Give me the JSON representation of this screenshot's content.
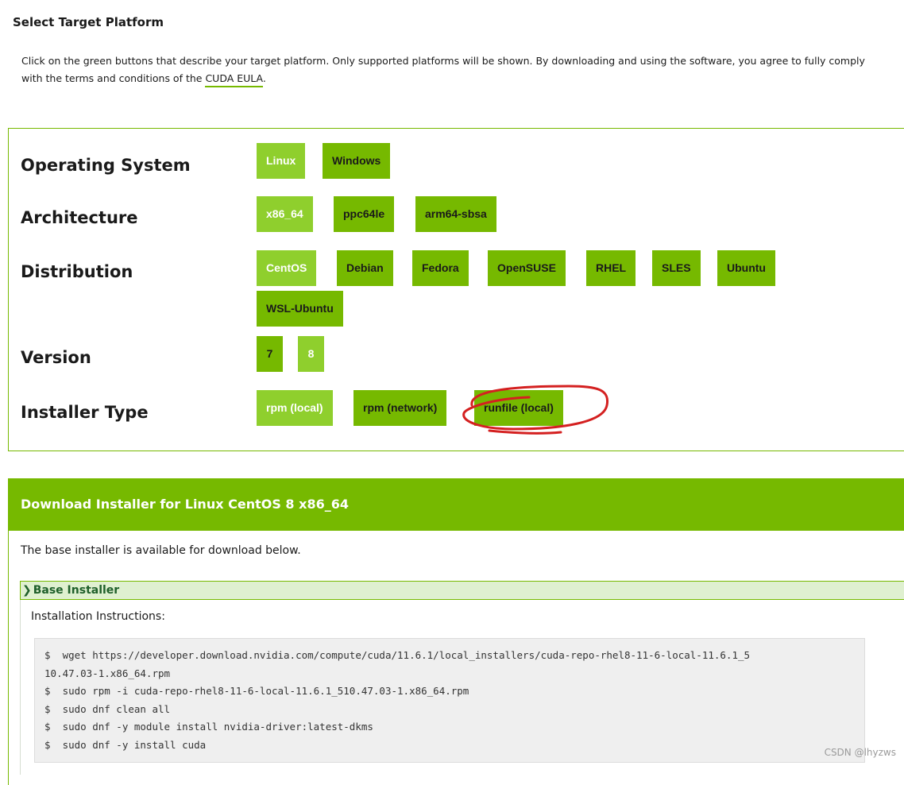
{
  "section_title": "Select Target Platform",
  "intro": {
    "text": "Click on the green buttons that describe your target platform. Only supported platforms will be shown. By downloading and using the software, you agree to fully comply with the terms and conditions of the ",
    "link": "CUDA EULA",
    "suffix": "."
  },
  "selector": {
    "operating_system": {
      "label": "Operating System",
      "options": [
        "Linux",
        "Windows"
      ],
      "selected": "Linux"
    },
    "architecture": {
      "label": "Architecture",
      "options": [
        "x86_64",
        "ppc64le",
        "arm64-sbsa"
      ],
      "selected": "x86_64"
    },
    "distribution": {
      "label": "Distribution",
      "options": [
        "CentOS",
        "Debian",
        "Fedora",
        "OpenSUSE",
        "RHEL",
        "SLES",
        "Ubuntu",
        "WSL-Ubuntu"
      ],
      "selected": "CentOS"
    },
    "version": {
      "label": "Version",
      "options": [
        "7",
        "8"
      ],
      "selected": "8"
    },
    "installer_type": {
      "label": "Installer Type",
      "options": [
        "rpm (local)",
        "rpm (network)",
        "runfile (local)"
      ],
      "selected": "rpm (local)"
    }
  },
  "download": {
    "header": "Download Installer for Linux CentOS 8 x86_64",
    "note": "The base installer is available for download below.",
    "base_installer_label": "Base Installer",
    "instructions_label": "Installation Instructions:",
    "code_lines": [
      "$  wget https://developer.download.nvidia.com/compute/cuda/11.6.1/local_installers/cuda-repo-rhel8-11-6-local-11.6.1_5",
      "10.47.03-1.x86_64.rpm",
      "$  sudo rpm -i cuda-repo-rhel8-11-6-local-11.6.1_510.47.03-1.x86_64.rpm",
      "$  sudo dnf clean all",
      "$  sudo dnf -y module install nvidia-driver:latest-dkms",
      "$  sudo dnf -y install cuda"
    ]
  },
  "watermark": "CSDN @lhyzws",
  "colors": {
    "accent": "#76b900",
    "selected": "#8fcf2d",
    "annotation": "#d42020"
  }
}
